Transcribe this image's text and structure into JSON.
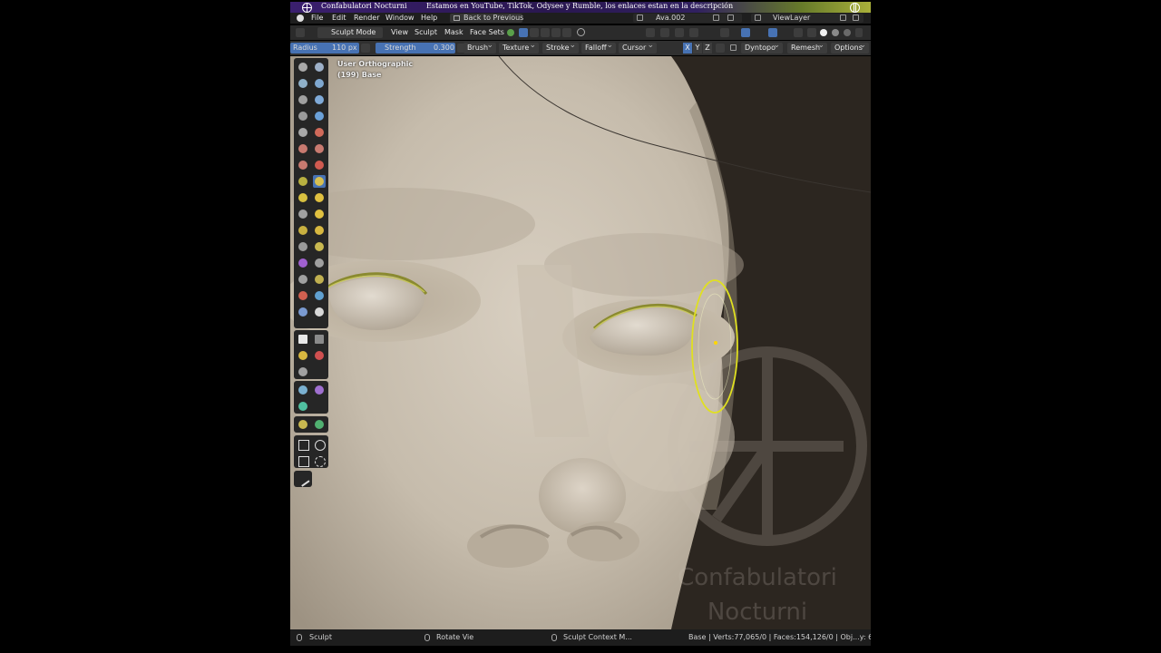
{
  "banner": {
    "channel": "Confabulatori Nocturni",
    "message": "Estamos en YouTube, TikTok, Odysee y Rumble, los enlaces estan en la descripción"
  },
  "menubar": {
    "items": [
      "File",
      "Edit",
      "Render",
      "Window",
      "Help"
    ],
    "back_button": "Back to Previous",
    "scene_name": "Ava.002",
    "view_layer": "ViewLayer"
  },
  "header": {
    "mode": "Sculpt Mode",
    "menus": [
      "View",
      "Sculpt",
      "Mask",
      "Face Sets"
    ]
  },
  "tool_settings": {
    "radius_label": "Radius",
    "radius_value": "110 px",
    "strength_label": "Strength",
    "strength_value": "0.300",
    "dropdowns": [
      "Brush",
      "Texture",
      "Stroke",
      "Falloff",
      "Cursor"
    ],
    "axes": [
      "X",
      "Y",
      "Z"
    ],
    "dyntopo": "Dyntopo",
    "remesh": "Remesh",
    "options": "Options"
  },
  "viewport": {
    "title": "User Orthographic",
    "subtitle": "(199) Base",
    "watermark_line1": "Confabulatori",
    "watermark_line2": "Nocturni"
  },
  "status_bar": {
    "left": "Sculpt",
    "middle": "Rotate Vie",
    "context": "Sculpt Context M...",
    "stats": "Base | Verts:77,065/0 | Faces:154,126/0 | Obj...y: 6"
  },
  "colors": {
    "accent_blue": "#4772b3",
    "brush_cursor": "#e0e020",
    "skin": "#c9bfb0",
    "background": "#2c2620"
  }
}
